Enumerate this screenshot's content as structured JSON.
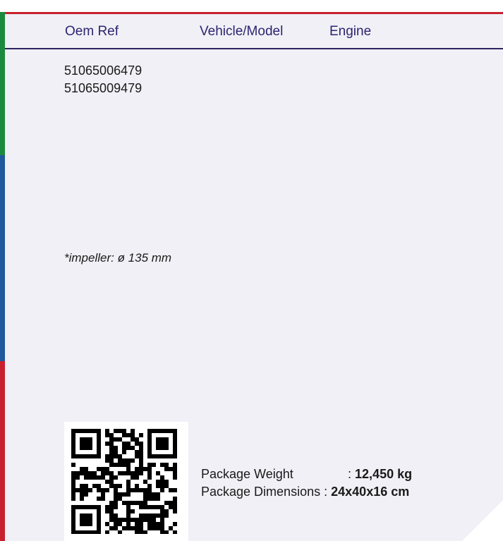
{
  "header": {
    "columns": [
      "Oem Ref",
      "Vehicle/Model",
      "Engine"
    ]
  },
  "oem_refs": [
    "51065006479",
    "51065009479"
  ],
  "note": "*impeller: ø 135 mm",
  "package": {
    "weight_label": "Package Weight",
    "weight_sep": ":",
    "weight_value": "12,450 kg",
    "dimensions_label": "Package Dimensions",
    "dimensions_sep": ":",
    "dimensions_value": "24x40x16 cm"
  },
  "colors": {
    "accent_red": "#c8202e",
    "accent_green": "#1c8a3e",
    "accent_blue": "#1e5a9c",
    "header_text": "#2d2470",
    "page_bg": "#f0f0f6"
  }
}
